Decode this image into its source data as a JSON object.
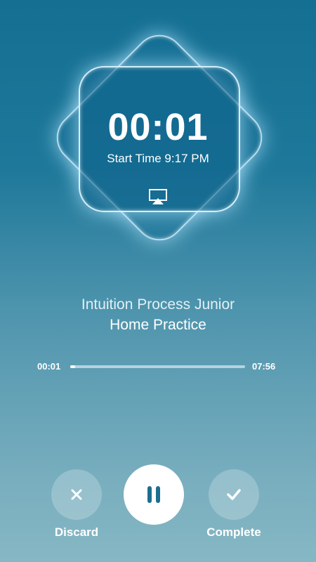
{
  "timer": {
    "elapsed": "00:01",
    "start_time": "Start Time 9:17 PM"
  },
  "session": {
    "title_line1": "Intuition Process Junior",
    "title_line2": "Home Practice"
  },
  "player": {
    "current_time": "00:01",
    "total_time": "07:56",
    "progress_fraction": 0.002
  },
  "controls": {
    "discard_label": "Discard",
    "complete_label": "Complete",
    "pause_icon": "pause-icon",
    "discard_icon": "close-icon",
    "complete_icon": "check-icon",
    "airplay_icon": "airplay-icon"
  },
  "colors": {
    "background_top": "#146f93",
    "background_bottom": "#86b7c4",
    "pause_icon_color": "#1d6e8f"
  }
}
